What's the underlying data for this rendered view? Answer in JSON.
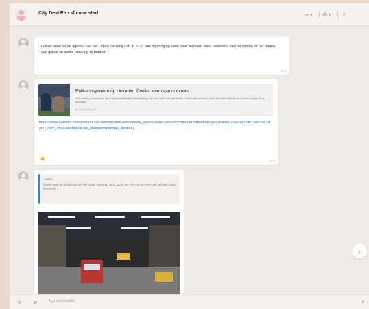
{
  "header": {
    "title": "City Deal Een slimme stad",
    "video_label": "▭",
    "call_label": "✆",
    "chevron": "▾",
    "search_label": "⌕"
  },
  "messages": [
    {
      "text": "Gelukt staat op de agenda van het Urban Sensing Lab in 2025. We zijn nog op zoek naar verhalen waar bewoners een rol spelen bij het meten van geluid en welke beleving zij hebben",
      "time": "10:12"
    },
    {
      "preview_title": "Ehlll-ecosysteem op LinkedIn: Zwolle: leven van concrete...",
      "preview_description": "Hoe bereik je bewoners bij de binnenstedelijke ontwikkeling van een stad? De gemeente Zwolle laat het door het in de volle breedte en te doen zonder toch bewuste",
      "preview_domain": "www.linkedin.com",
      "link": "https://www.linkedin.com/posts/dutch-metropolitan-innovations_zwolle-leven-van-concrete-herontwikkelingen-activity-7267092290158830624-yfY_?utm_source=share&utm_medium=member_desktop",
      "reaction": "👍",
      "time": "10:13"
    },
    {
      "quote_author": "~Gerrit",
      "quote_text": "Gelukt staat op de agenda van het Urban Sensing Lab in 2025. We zijn nog op zoek naar verhalen waar bewoners..."
    }
  ],
  "composer": {
    "placeholder": "Typ een bericht"
  },
  "icons": {
    "emoji": "☺",
    "attach": "⌀",
    "mic": "♀",
    "scroll_down": "↓"
  }
}
